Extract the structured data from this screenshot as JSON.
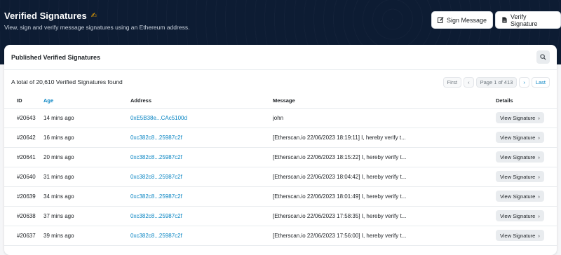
{
  "header": {
    "title": "Verified Signatures",
    "subtitle": "View, sign and verify message signatures using an Ethereum address.",
    "sign_button": "Sign Message",
    "verify_button": "Verify Signature"
  },
  "card": {
    "title": "Published Verified Signatures",
    "summary": "A total of 20,610 Verified Signatures found",
    "pager": {
      "first": "First",
      "page": "Page 1 of 413",
      "last": "Last"
    }
  },
  "table": {
    "columns": [
      "ID",
      "Age",
      "Address",
      "Message",
      "Details"
    ],
    "rows": [
      {
        "id": "#20643",
        "age": "14 mins ago",
        "address": "0xE5B38e...CAc5100d",
        "message": "john",
        "details": "View Signature"
      },
      {
        "id": "#20642",
        "age": "16 mins ago",
        "address": "0xc382c8...25987c2f",
        "message": "[Etherscan.io 22/06/2023 18:19:11] I, hereby verify t...",
        "details": "View Signature"
      },
      {
        "id": "#20641",
        "age": "20 mins ago",
        "address": "0xc382c8...25987c2f",
        "message": "[Etherscan.io 22/06/2023 18:15:22] I, hereby verify t...",
        "details": "View Signature"
      },
      {
        "id": "#20640",
        "age": "31 mins ago",
        "address": "0xc382c8...25987c2f",
        "message": "[Etherscan.io 22/06/2023 18:04:42] I, hereby verify t...",
        "details": "View Signature"
      },
      {
        "id": "#20639",
        "age": "34 mins ago",
        "address": "0xc382c8...25987c2f",
        "message": "[Etherscan.io 22/06/2023 18:01:49] I, hereby verify t...",
        "details": "View Signature"
      },
      {
        "id": "#20638",
        "age": "37 mins ago",
        "address": "0xc382c8...25987c2f",
        "message": "[Etherscan.io 22/06/2023 17:58:35] I, hereby verify t...",
        "details": "View Signature"
      },
      {
        "id": "#20637",
        "age": "39 mins ago",
        "address": "0xc382c8...25987c2f",
        "message": "[Etherscan.io 22/06/2023 17:56:00] I, hereby verify t...",
        "details": "View Signature"
      }
    ]
  },
  "icons": {
    "title_icon": "hand-signature-icon",
    "sign_icon": "pen-square-icon",
    "verify_icon": "file-icon",
    "search_icon": "search-icon"
  },
  "colors": {
    "hero_bg": "#0d1c33",
    "link": "#0784c3",
    "accent": "#f0a500"
  }
}
